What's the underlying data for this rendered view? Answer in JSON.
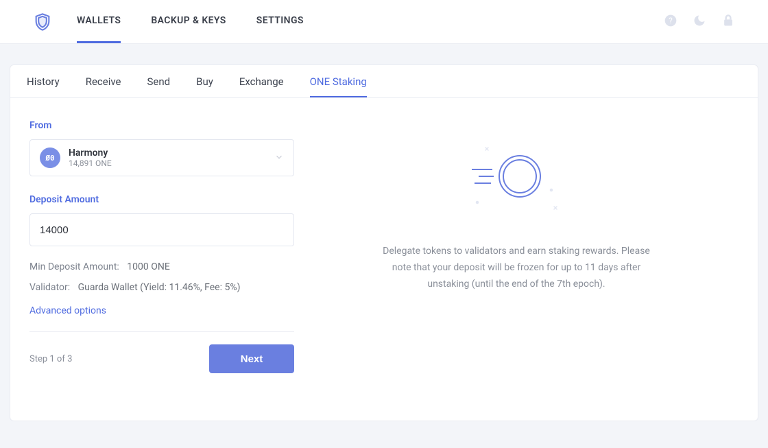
{
  "nav": {
    "items": [
      "WALLETS",
      "BACKUP & KEYS",
      "SETTINGS"
    ],
    "active": 0
  },
  "subnav": {
    "items": [
      "History",
      "Receive",
      "Send",
      "Buy",
      "Exchange",
      "ONE Staking"
    ],
    "active": 5
  },
  "staking": {
    "from_label": "From",
    "wallet": {
      "name": "Harmony",
      "balance": "14,891 ONE",
      "icon_symbol": "Ø0"
    },
    "amount_label": "Deposit Amount",
    "amount_value": "14000",
    "min_row": {
      "label": "Min Deposit Amount:",
      "value": "1000 ONE"
    },
    "validator_row": {
      "label": "Validator:",
      "value": "Guarda Wallet (Yield: 11.46%, Fee: 5%)"
    },
    "advanced_label": "Advanced options",
    "step_text": "Step 1 of 3",
    "next_label": "Next"
  },
  "explainer": "Delegate tokens to validators and earn staking rewards. Please note that your deposit will be frozen for up to 11 days after unstaking (until the end of the 7th epoch)."
}
